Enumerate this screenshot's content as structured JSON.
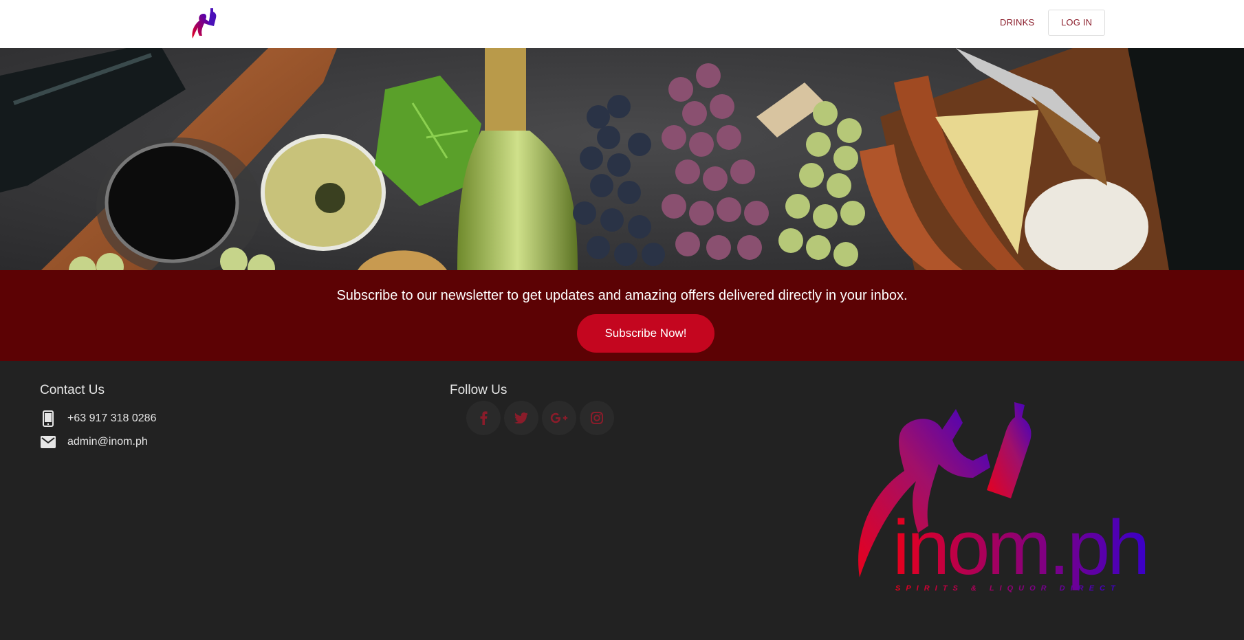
{
  "nav": {
    "logo": "inom.ph logo",
    "drinks_label": "DRINKS",
    "login_label": "LOG IN"
  },
  "hero": {
    "image": "wine, grapes, cheese and sausages spread"
  },
  "newsletter": {
    "text": "Subscribe to our newsletter to get updates and amazing offers delivered directly in your inbox.",
    "button_label": "Subscribe Now!"
  },
  "footer": {
    "contact": {
      "heading": "Contact Us",
      "phone": "+63 917 318 0286",
      "email": "admin@inom.ph"
    },
    "follow": {
      "heading": "Follow Us",
      "icons": [
        "facebook-icon",
        "twitter-icon",
        "google-plus-icon",
        "instagram-icon"
      ]
    },
    "logo": {
      "wordmark": "inom.ph",
      "tagline": "SPIRITS & LIQUOR DIRECT"
    }
  },
  "colors": {
    "brand_red": "#c4061f",
    "newsletter_bg": "#5c0204",
    "footer_bg": "#222222",
    "link_color": "#8a1c2a",
    "logo_gradient_start": "#e8001c",
    "logo_gradient_end": "#3a00c8"
  }
}
